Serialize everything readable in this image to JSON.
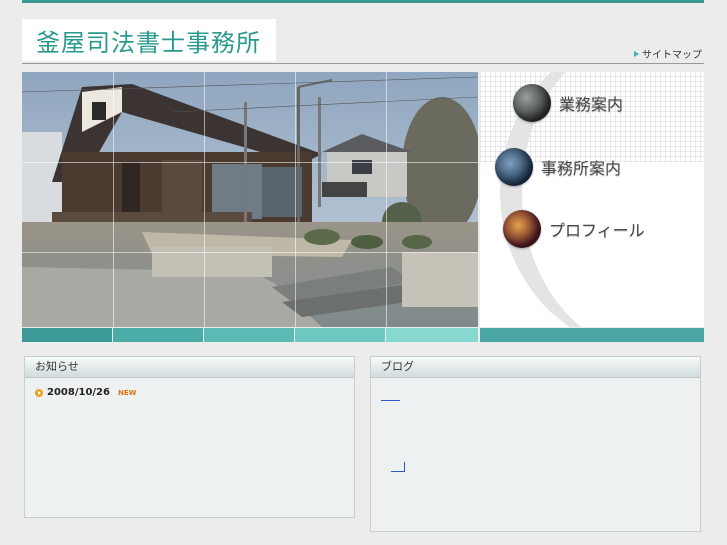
{
  "header": {
    "logo_text": "釜屋司法書士事務所",
    "sitemap_label": "サイトマップ"
  },
  "menu": {
    "items": [
      {
        "label": "業務案内",
        "icon": "scales-icon"
      },
      {
        "label": "事務所案内",
        "icon": "building-icon"
      },
      {
        "label": "プロフィール",
        "icon": "lights-icon"
      }
    ]
  },
  "news": {
    "title": "お知らせ",
    "entries": [
      {
        "date": "2008/10/26",
        "badge": "NEW"
      }
    ]
  },
  "blog": {
    "title": "ブログ"
  },
  "colors": {
    "accent": "#3c9a96",
    "logo": "#2a9a8e",
    "background": "#ececec"
  }
}
